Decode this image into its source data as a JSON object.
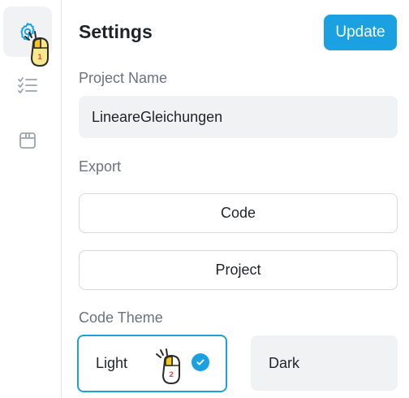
{
  "sidebar": {
    "items": [
      {
        "name": "settings",
        "icon": "gear-icon",
        "active": true
      },
      {
        "name": "checklist",
        "icon": "checklist-icon",
        "active": false
      },
      {
        "name": "box",
        "icon": "box-icon",
        "active": false
      }
    ]
  },
  "header": {
    "title": "Settings",
    "update_label": "Update"
  },
  "project_name": {
    "label": "Project Name",
    "value": "LineareGleichungen"
  },
  "export": {
    "label": "Export",
    "code_label": "Code",
    "project_label": "Project"
  },
  "code_theme": {
    "label": "Code Theme",
    "options": [
      "Light",
      "Dark"
    ],
    "selected": "Light"
  },
  "cursors": [
    {
      "step": "1",
      "icon": "mouse-click-icon"
    },
    {
      "step": "2",
      "icon": "mouse-click-icon"
    }
  ],
  "colors": {
    "accent": "#1ba1e2",
    "muted_text": "#6b7280",
    "field_bg": "#f1f2f4"
  }
}
